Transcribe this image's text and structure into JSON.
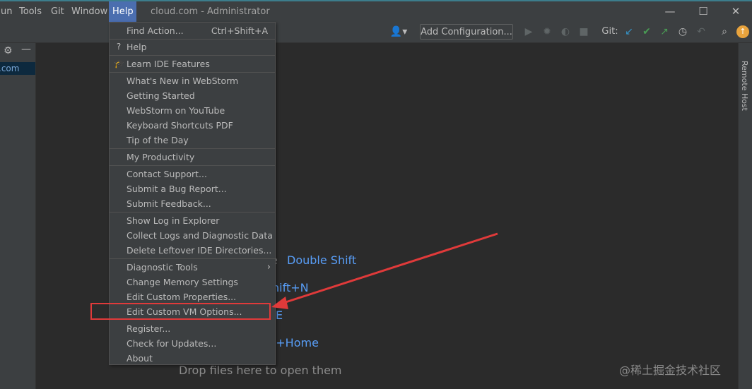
{
  "menubar": {
    "items": [
      {
        "label": "un"
      },
      {
        "label": "Tools"
      },
      {
        "label": "Git"
      },
      {
        "label": "Window"
      },
      {
        "label": "Help",
        "active": true
      }
    ],
    "title": "cloud.com - Administrator"
  },
  "window_controls": {
    "minimize": "—",
    "maximize": "☐",
    "close": "✕"
  },
  "toolbar": {
    "add_configuration": "Add Configuration...",
    "git_label": "Git:"
  },
  "left_panel": {
    "selected_item": ".com"
  },
  "right_bar": {
    "remote_host": "Remote Host"
  },
  "help_menu": {
    "groups": [
      [
        {
          "label": "Find Action...",
          "shortcut": "Ctrl+Shift+A"
        }
      ],
      [
        {
          "label": "Help",
          "icon": "?"
        }
      ],
      [
        {
          "label": "Learn IDE Features",
          "icon": "graduation-cap"
        }
      ],
      [
        {
          "label": "What's New in WebStorm"
        },
        {
          "label": "Getting Started"
        },
        {
          "label": "WebStorm on YouTube"
        },
        {
          "label": "Keyboard Shortcuts PDF"
        },
        {
          "label": "Tip of the Day"
        }
      ],
      [
        {
          "label": "My Productivity"
        }
      ],
      [
        {
          "label": "Contact Support..."
        },
        {
          "label": "Submit a Bug Report..."
        },
        {
          "label": "Submit Feedback..."
        }
      ],
      [
        {
          "label": "Show Log in Explorer"
        },
        {
          "label": "Collect Logs and Diagnostic Data"
        },
        {
          "label": "Delete Leftover IDE Directories..."
        }
      ],
      [
        {
          "label": "Diagnostic Tools",
          "submenu": true
        },
        {
          "label": "Change Memory Settings"
        },
        {
          "label": "Edit Custom Properties..."
        },
        {
          "label": "Edit Custom VM Options...",
          "highlighted_annotation": true
        },
        {
          "label": "Register..."
        },
        {
          "label": "Check for Updates..."
        },
        {
          "label": "About"
        }
      ]
    ]
  },
  "welcome_hints": {
    "partial_e": "e",
    "double_shift": "Double Shift",
    "shift_n": "hift+N",
    "e_frag": "E",
    "home": "t+Home",
    "drop_files": "Drop files here to open them"
  },
  "watermark": "@稀土掘金技术社区",
  "colors": {
    "menu_bg": "#3c3f41",
    "editor_bg": "#2b2b2b",
    "accent": "#4b6eaf",
    "link": "#589df6",
    "annotation_red": "#e03a3a"
  }
}
